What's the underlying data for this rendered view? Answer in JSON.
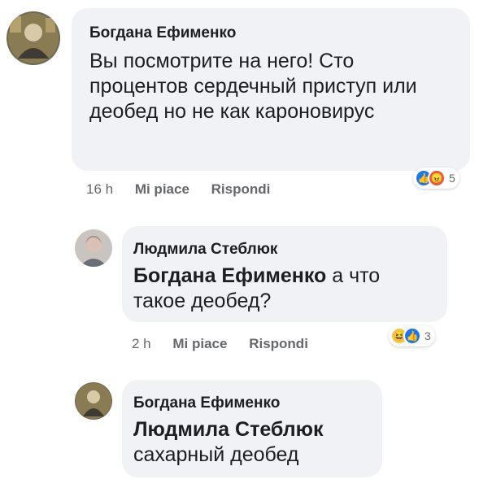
{
  "comments": [
    {
      "author": "Богдана Ефименко",
      "text": "Вы посмотрите на него! Сто процентов сердечный приступ или деобед но не как кароновирус",
      "time": "16 h",
      "like_label": "Mi piace",
      "reply_label": "Rispondi",
      "reaction_count": "5",
      "reactions": [
        "like-icon",
        "angry-icon"
      ]
    },
    {
      "author": "Людмила Стеблюк",
      "mention": "Богдана Ефименко",
      "text": " а что такое деобед?",
      "time": "2 h",
      "like_label": "Mi piace",
      "reply_label": "Rispondi",
      "reaction_count": "3",
      "reactions": [
        "haha-icon",
        "like-icon"
      ]
    },
    {
      "author": "Богдана Ефименко",
      "mention": "Людмила Стеблюк",
      "text": "сахарный деобед"
    }
  ],
  "colors": {
    "bubble": "#f0f2f5",
    "meta_text": "#65676b",
    "like": "#1877f2",
    "angry": "#f0533a",
    "haha": "#f7c44a"
  }
}
